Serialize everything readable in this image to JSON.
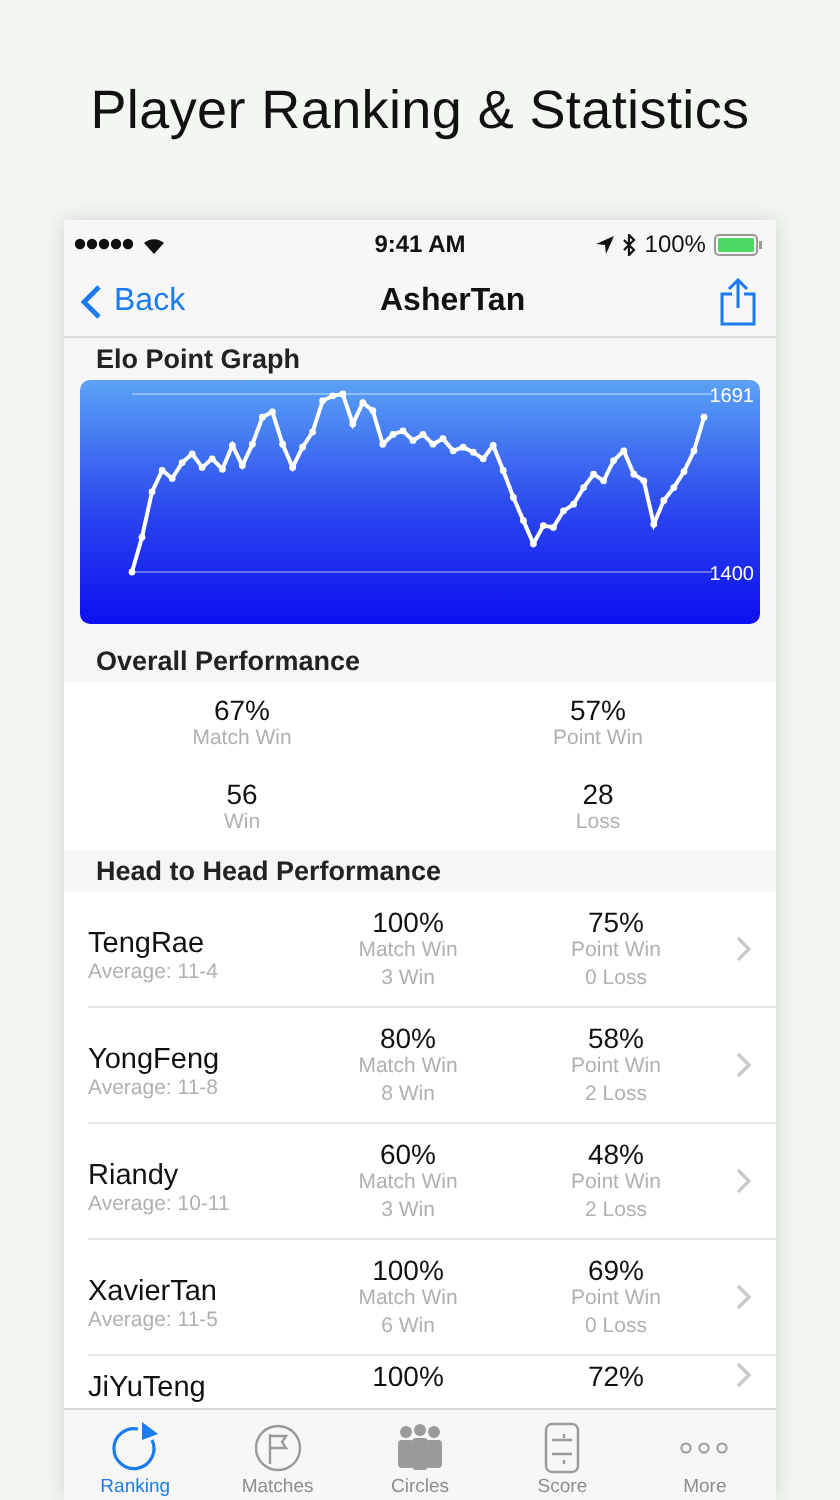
{
  "headline": "Player Ranking & Statistics",
  "status_bar": {
    "time": "9:41 AM",
    "battery": "100%"
  },
  "nav": {
    "back": "Back",
    "title": "AsherTan"
  },
  "elo": {
    "title": "Elo Point Graph",
    "chart_data": {
      "type": "line",
      "ylim": [
        1400,
        1691
      ],
      "yticks": [
        1400,
        1691
      ],
      "series": [
        {
          "color": "#ffffff",
          "marker": "circle",
          "values": [
            1400,
            1457,
            1531,
            1566,
            1553,
            1579,
            1593,
            1571,
            1585,
            1568,
            1607,
            1574,
            1609,
            1653,
            1662,
            1609,
            1571,
            1604,
            1629,
            1680,
            1688,
            1691,
            1642,
            1677,
            1664,
            1609,
            1625,
            1631,
            1615,
            1625,
            1609,
            1618,
            1598,
            1604,
            1596,
            1585,
            1607,
            1566,
            1522,
            1484,
            1446,
            1476,
            1473,
            1500,
            1511,
            1538,
            1560,
            1549,
            1582,
            1598,
            1560,
            1549,
            1478,
            1517,
            1538,
            1564,
            1598,
            1653
          ]
        }
      ]
    }
  },
  "overall": {
    "title": "Overall Performance",
    "stats": [
      {
        "value": "67%",
        "label": "Match Win"
      },
      {
        "value": "57%",
        "label": "Point Win"
      },
      {
        "value": "56",
        "label": "Win"
      },
      {
        "value": "28",
        "label": "Loss"
      }
    ]
  },
  "head_to_head": {
    "title": "Head to Head Performance",
    "rows": [
      {
        "name": "TengRae",
        "average": "Average: 11-4",
        "match_pct": "100%",
        "match_label": "Match Win",
        "wins": "3 Win",
        "point_pct": "75%",
        "point_label": "Point Win",
        "losses": "0 Loss"
      },
      {
        "name": "YongFeng",
        "average": "Average: 11-8",
        "match_pct": "80%",
        "match_label": "Match Win",
        "wins": "8 Win",
        "point_pct": "58%",
        "point_label": "Point Win",
        "losses": "2 Loss"
      },
      {
        "name": "Riandy",
        "average": "Average: 10-11",
        "match_pct": "60%",
        "match_label": "Match Win",
        "wins": "3 Win",
        "point_pct": "48%",
        "point_label": "Point Win",
        "losses": "2 Loss"
      },
      {
        "name": "XavierTan",
        "average": "Average: 11-5",
        "match_pct": "100%",
        "match_label": "Match Win",
        "wins": "6 Win",
        "point_pct": "69%",
        "point_label": "Point Win",
        "losses": "0 Loss"
      },
      {
        "name": "JiYuTeng",
        "match_pct": "100%",
        "point_pct": "72%"
      }
    ]
  },
  "tabs": [
    {
      "label": "Ranking",
      "kind": "ranking",
      "selected": true
    },
    {
      "label": "Matches",
      "kind": "matches",
      "selected": false
    },
    {
      "label": "Circles",
      "kind": "circles",
      "selected": false
    },
    {
      "label": "Score",
      "kind": "score",
      "selected": false
    },
    {
      "label": "More",
      "kind": "more",
      "selected": false
    }
  ]
}
